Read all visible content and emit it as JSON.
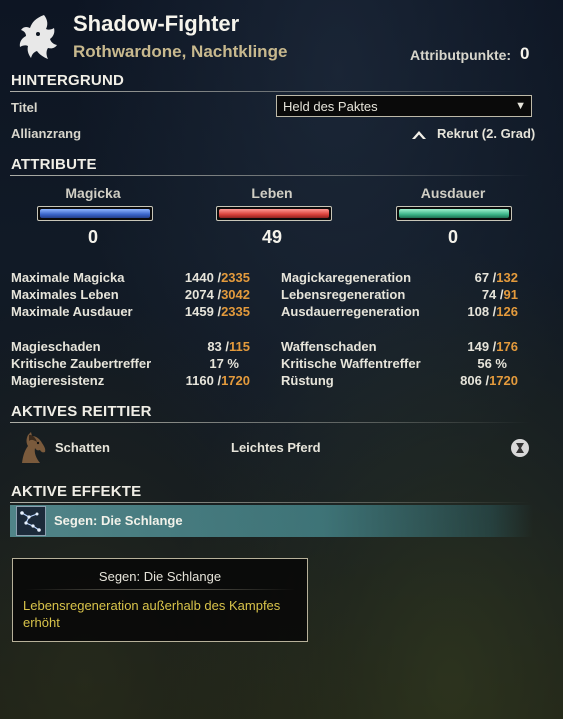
{
  "header": {
    "name": "Shadow-Fighter",
    "subtitle": "Rothwardone, Nachtklinge",
    "attr_points_label": "Attributpunkte:",
    "attr_points_value": "0"
  },
  "background": {
    "title": "HINTERGRUND",
    "titel_label": "Titel",
    "titel_value": "Held des Paktes",
    "rank_label": "Allianzrang",
    "rank_value": "Rekrut (2. Grad)"
  },
  "attributes": {
    "title": "ATTRIBUTE",
    "items": [
      {
        "label": "Magicka",
        "value": "0",
        "color": "#4a7bd6"
      },
      {
        "label": "Leben",
        "value": "49",
        "color": "#d9443e"
      },
      {
        "label": "Ausdauer",
        "value": "0",
        "color": "#3fb58a"
      }
    ]
  },
  "stats": {
    "left": [
      {
        "label": "Maximale Magicka",
        "base": "1440",
        "current": "2335"
      },
      {
        "label": "Maximales Leben",
        "base": "2074",
        "current": "3042"
      },
      {
        "label": "Maximale Ausdauer",
        "base": "1459",
        "current": "2335"
      },
      {
        "label": "Magieschaden",
        "base": "83",
        "current": "115"
      },
      {
        "label": "Kritische Zaubertreffer",
        "base": "17 %",
        "current": ""
      },
      {
        "label": "Magieresistenz",
        "base": "1160",
        "current": "1720"
      }
    ],
    "right": [
      {
        "label": "Magickaregeneration",
        "base": "67",
        "current": "132"
      },
      {
        "label": "Lebensregeneration",
        "base": "74",
        "current": "91"
      },
      {
        "label": "Ausdauerregeneration",
        "base": "108",
        "current": "126"
      },
      {
        "label": "Waffenschaden",
        "base": "149",
        "current": "176"
      },
      {
        "label": "Kritische Waffentreffer",
        "base": "56 %",
        "current": ""
      },
      {
        "label": "Rüstung",
        "base": "806",
        "current": "1720"
      }
    ]
  },
  "mount": {
    "title": "AKTIVES REITTIER",
    "name": "Schatten",
    "type": "Leichtes Pferd"
  },
  "effects": {
    "title": "AKTIVE EFFEKTE",
    "active": "Segen: Die Schlange",
    "tooltip_title": "Segen: Die Schlange",
    "tooltip_desc": "Lebensregeneration außerhalb des Kampfes erhöht"
  }
}
